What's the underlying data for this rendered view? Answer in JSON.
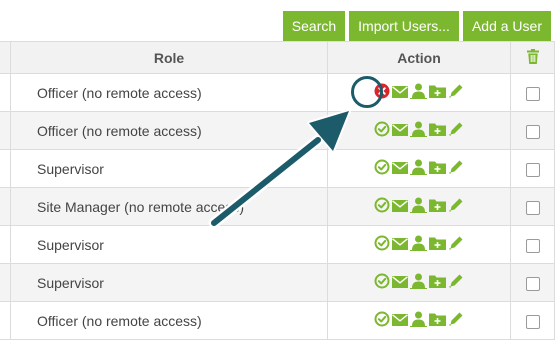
{
  "toolbar": {
    "search_label": "Search",
    "import_label": "Import Users...",
    "add_label": "Add a User"
  },
  "table": {
    "headers": {
      "role": "Role",
      "action": "Action"
    },
    "rows": [
      {
        "role": "Officer (no remote access)",
        "status": "disabled"
      },
      {
        "role": "Officer (no remote access)",
        "status": "active"
      },
      {
        "role": "Supervisor",
        "status": "active"
      },
      {
        "role": "Site Manager (no remote access)",
        "status": "active"
      },
      {
        "role": "Supervisor",
        "status": "active"
      },
      {
        "role": "Supervisor",
        "status": "active"
      },
      {
        "role": "Officer (no remote access)",
        "status": "active"
      }
    ]
  },
  "icons": {
    "status_active": "check-circle-icon",
    "status_disabled": "x-circle-icon",
    "email": "envelope-icon",
    "user": "user-icon",
    "folder": "folder-plus-icon",
    "edit": "pencil-icon",
    "header_delete": "trash-icon"
  },
  "colors": {
    "accent_green": "#7cb82f",
    "disabled_red": "#d9252b",
    "annotation_teal": "#1c5b6a"
  }
}
